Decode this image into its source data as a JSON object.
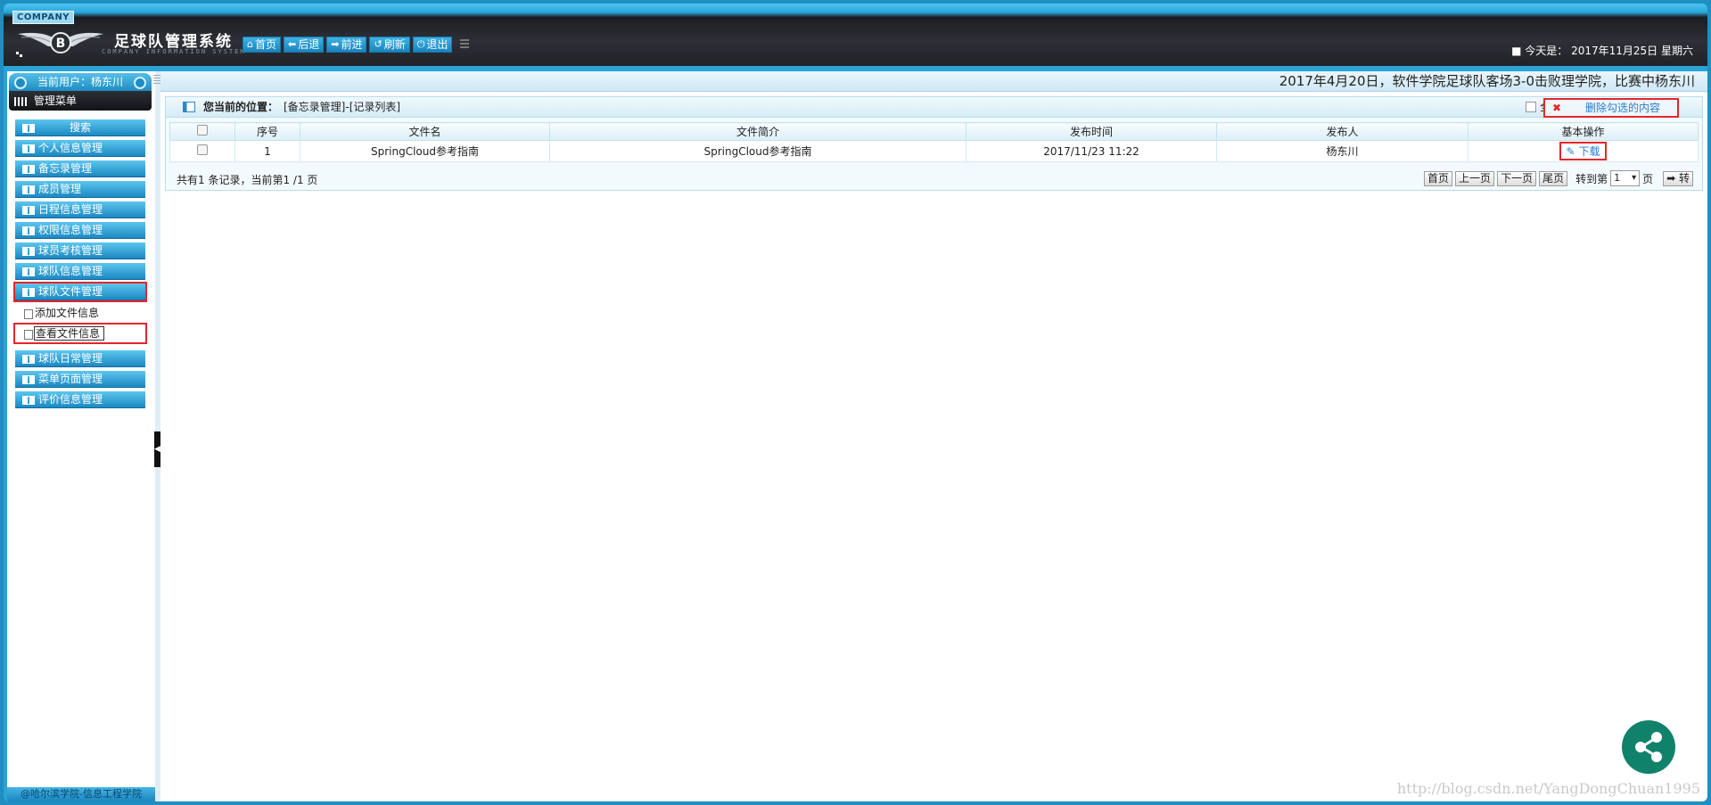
{
  "header": {
    "company": "COMPANY",
    "title": "足球队管理系统",
    "subtitle": "COMPANY INFORMATION SYSTEM",
    "nav": [
      {
        "label": "首页",
        "icon": "home-icon"
      },
      {
        "label": "后退",
        "icon": "arrow-left-icon"
      },
      {
        "label": "前进",
        "icon": "arrow-right-icon"
      },
      {
        "label": "刷新",
        "icon": "refresh-icon"
      },
      {
        "label": "退出",
        "icon": "power-icon"
      }
    ],
    "today": "■ 今天是： 2017年11月25日 星期六"
  },
  "sidebar": {
    "user": "当前用户：杨东川",
    "menu_title": "管理菜单",
    "search": "搜索",
    "items": [
      {
        "label": "个人信息管理"
      },
      {
        "label": "备忘录管理"
      },
      {
        "label": "成员管理"
      },
      {
        "label": "日程信息管理"
      },
      {
        "label": "权限信息管理"
      },
      {
        "label": "球员考核管理"
      },
      {
        "label": "球队信息管理"
      },
      {
        "label": "球队文件管理"
      }
    ],
    "subitems": [
      {
        "label": "添加文件信息"
      },
      {
        "label": "查看文件信息"
      }
    ],
    "items_after": [
      {
        "label": "球队日常管理"
      },
      {
        "label": "菜单页面管理"
      },
      {
        "label": "评价信息管理"
      }
    ],
    "footer": "@哈尔滨学院-信息工程学院"
  },
  "main": {
    "marquee": "2017年4月20日，软件学院足球队客场3-0击败理学院，比赛中杨东川",
    "position_label": "您当前的位置：",
    "position_path": "[备忘录管理]-[记录列表]",
    "select_all": "全选",
    "delete_label": "删除勾选的内容",
    "columns": [
      "序号",
      "文件名",
      "文件简介",
      "发布时间",
      "发布人",
      "基本操作"
    ],
    "rows": [
      {
        "no": "1",
        "name": "SpringCloud参考指南",
        "desc": "SpringCloud参考指南",
        "time": "2017/11/23 11:22",
        "author": "杨东川",
        "action": "下载"
      }
    ],
    "summary": "共有1 条记录，当前第1 /1 页",
    "pager": {
      "first": "首页",
      "prev": "上一页",
      "next": "下一页",
      "last": "尾页",
      "goto": "转到第",
      "page": "1",
      "unit": "页",
      "go": "➡ 转"
    }
  },
  "watermark": "http://blog.csdn.net/YangDongChuan1995",
  "colors": {
    "accent": "#2aa6dc",
    "highlight": "#e5262b",
    "share": "#10826a"
  }
}
